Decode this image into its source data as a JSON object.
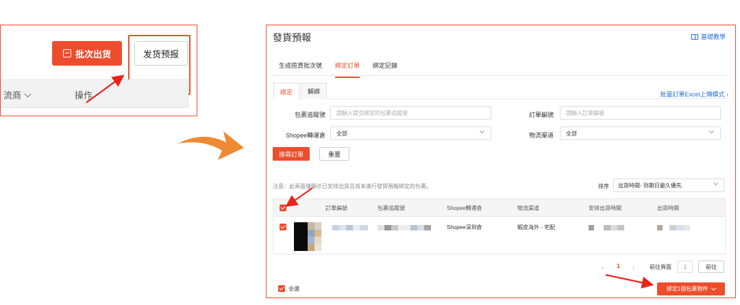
{
  "left_panel": {
    "batch_ship_label": "批次出货",
    "forecast_label": "发货预报",
    "column_1_label": "流商",
    "column_2_label": "操作"
  },
  "right_panel": {
    "title": "發貨預報",
    "help_link": "基礎教學",
    "tabs": [
      {
        "label": "生成揽貨批次號",
        "active": false
      },
      {
        "label": "綁定訂單",
        "active": true
      },
      {
        "label": "綁定記錄",
        "active": false
      }
    ],
    "subtabs": [
      {
        "label": "綁定",
        "active": true
      },
      {
        "label": "解綁",
        "active": false
      }
    ],
    "batch_upload_link": "批量訂單Excel上傳模式",
    "form": {
      "package_tracking_label": "包裹追蹤號",
      "package_tracking_placeholder": "請輸入提交綁定的包裹追蹤號",
      "order_no_label": "訂單編號",
      "order_no_placeholder": "請輸入訂單編號",
      "warehouse_label": "Shopee轉運倉",
      "warehouse_value": "全部",
      "channel_label": "物流渠道",
      "channel_value": "全部"
    },
    "search_button": "搜尋訂單",
    "reset_button": "重置",
    "note": "注意：此頁面僅顯示已安排出貨且尚未進行發貨預報綁定的包裹。",
    "sort_label": "排序",
    "sort_value": "出貨時間- 到期日最久優先",
    "table": {
      "headers": [
        "訂單編號",
        "包裹追蹤號",
        "Shopee轉運倉",
        "物流渠道",
        "安排出貨時間",
        "出貨時間"
      ],
      "rows": [
        {
          "warehouse": "Shopee深圳倉",
          "channel": "蝦皮海外 - 宅配"
        }
      ]
    },
    "pagination": {
      "current_page": "1",
      "goto_label": "前往頁面",
      "goto_value": "1",
      "go_button": "前往"
    },
    "select_all_label": "全選",
    "bind_button": "綁定1個包裹物件"
  },
  "colors": {
    "accent": "#ee4d2d",
    "link": "#2673dd",
    "arrow": "#ee8a33"
  }
}
